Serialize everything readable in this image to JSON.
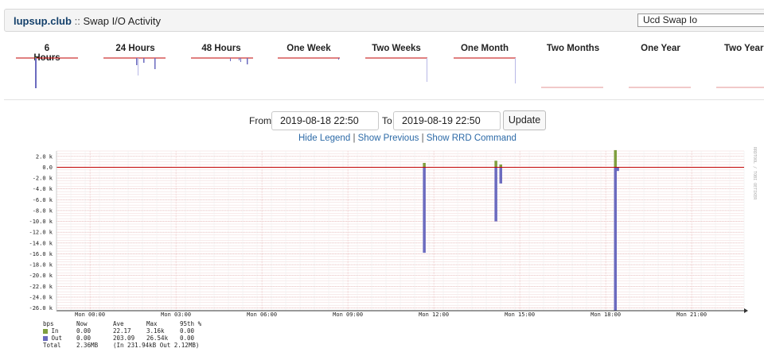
{
  "header": {
    "site": "lupsup.club",
    "separator": "::",
    "title": "Swap I/O Activity",
    "selector": "Ucd Swap Io"
  },
  "tabs": [
    {
      "label": "6 Hours"
    },
    {
      "label": "24 Hours"
    },
    {
      "label": "48 Hours"
    },
    {
      "label": "One Week"
    },
    {
      "label": "Two Weeks"
    },
    {
      "label": "One Month"
    },
    {
      "label": "Two Months"
    },
    {
      "label": "One Year"
    },
    {
      "label": "Two Years"
    }
  ],
  "form": {
    "from_label": "From",
    "from_value": "2019-08-18 22:50",
    "to_label": "To",
    "to_value": "2019-08-19 22:50",
    "update_label": "Update"
  },
  "links": {
    "hide_legend": "Hide Legend",
    "show_previous": "Show Previous",
    "show_rrd": "Show RRD Command",
    "divider": "|"
  },
  "watermark": "RRDTOOL / TOBI OETIKER",
  "colors": {
    "in": "#7f9f3f",
    "out": "#6b6bbf",
    "baseline": "#c00000",
    "link": "#2c6aa7"
  },
  "chart_data": {
    "type": "bar",
    "ylim": [
      -26.5,
      3.0
    ],
    "yticks": [
      "2.0 k",
      "0.0",
      "-2.0 k",
      "-4.0 k",
      "-6.0 k",
      "-8.0 k",
      "-10.0 k",
      "-12.0 k",
      "-14.0 k",
      "-16.0 k",
      "-18.0 k",
      "-20.0 k",
      "-22.0 k",
      "-24.0 k",
      "-26.0 k"
    ],
    "ytick_values": [
      2,
      0,
      -2,
      -4,
      -6,
      -8,
      -10,
      -12,
      -14,
      -16,
      -18,
      -20,
      -22,
      -24,
      -26
    ],
    "xticks": [
      "Mon 00:00",
      "Mon 03:00",
      "Mon 06:00",
      "Mon 09:00",
      "Mon 12:00",
      "Mon 15:00",
      "Mon 18:00",
      "Mon 21:00"
    ],
    "xtick_hours": [
      1.17,
      4.17,
      7.17,
      10.17,
      13.17,
      16.17,
      19.17,
      22.17
    ],
    "x_range_hours": [
      0,
      24
    ],
    "grid": true,
    "series": [
      {
        "name": "In",
        "bars": [
          {
            "x": 12.83,
            "v": 0.8
          },
          {
            "x": 15.33,
            "v": 1.2
          },
          {
            "x": 15.5,
            "v": 0.5
          },
          {
            "x": 19.5,
            "v": 3.16
          }
        ]
      },
      {
        "name": "Out",
        "bars": [
          {
            "x": 12.83,
            "v": -15.8
          },
          {
            "x": 15.33,
            "v": -10.0
          },
          {
            "x": 15.5,
            "v": -3.0
          },
          {
            "x": 19.5,
            "v": -26.54
          },
          {
            "x": 19.58,
            "v": -0.7
          }
        ]
      }
    ]
  },
  "legend": {
    "headers": [
      "bps",
      "Now",
      "Ave",
      "Max",
      "95th %"
    ],
    "rows": [
      {
        "name": "In",
        "now": "0.00",
        "ave": "22.17",
        "max": "3.16k",
        "p95": "0.00"
      },
      {
        "name": "Out",
        "now": "0.00",
        "ave": "203.09",
        "max": "26.54k",
        "p95": "0.00"
      }
    ],
    "total": {
      "label": "Total",
      "value": "2.36MB",
      "detail": "(In 231.94kB  Out   2.12MB)"
    }
  }
}
